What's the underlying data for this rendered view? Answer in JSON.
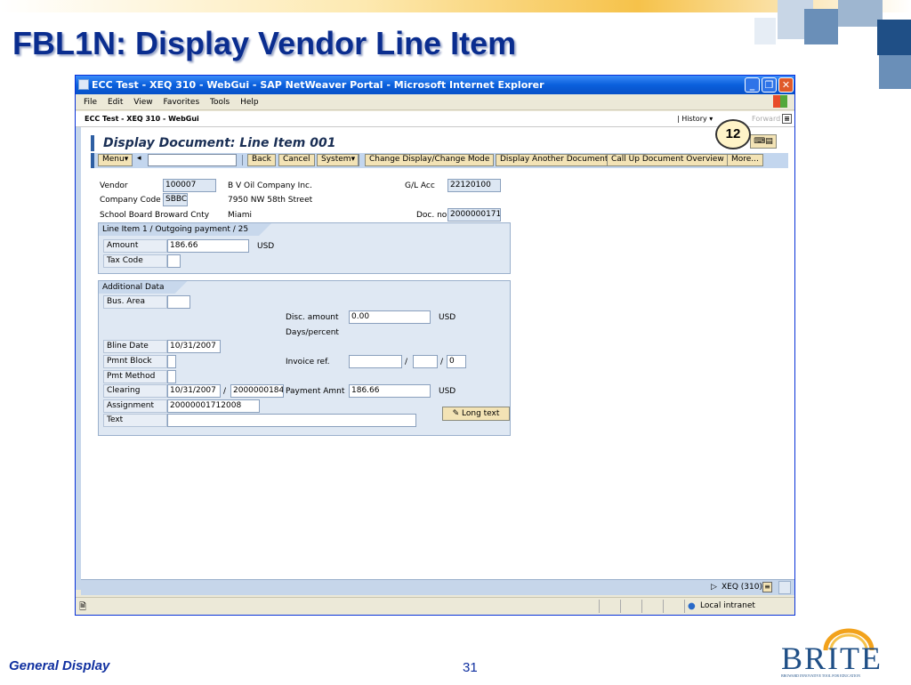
{
  "slide": {
    "title": "FBL1N: Display Vendor Line Item",
    "footer_left": "General Display",
    "page_number": "31",
    "callout": "12",
    "brite_logo": "BRITE",
    "brite_tagline": "BROWARD INNOVATIVE TOOL FOR EDUCATION"
  },
  "browser": {
    "window_title": "ECC Test - XEQ 310 - WebGui - SAP NetWeaver Portal - Microsoft Internet Explorer",
    "menu": [
      "File",
      "Edit",
      "View",
      "Favorites",
      "Tools",
      "Help"
    ],
    "portal_title": "ECC Test - XEQ 310 - WebGui",
    "history": "History",
    "forward": "Forward",
    "status_zone": "Local intranet"
  },
  "sap": {
    "page_title": "Display Document: Line Item 001",
    "toolbar": {
      "menu": "Menu",
      "back": "Back",
      "cancel": "Cancel",
      "system": "System",
      "change_mode": "Change Display/Change Mode",
      "another_doc": "Display Another Document",
      "call_up": "Call Up Document Overview",
      "more": "More..."
    },
    "header": {
      "vendor_label": "Vendor",
      "vendor": "100007",
      "vendor_name": "B V Oil Company Inc.",
      "glacc_label": "G/L Acc",
      "glacc": "22120100",
      "company_label": "Company Code",
      "company": "SBBC",
      "street": "7950 NW 58th Street",
      "school": "School Board Broward Cnty",
      "city": "Miami",
      "docno_label": "Doc. no.",
      "docno": "2000000171"
    },
    "line_item": {
      "heading": "Line Item 1 / Outgoing payment / 25",
      "amount_label": "Amount",
      "amount": "186.66",
      "currency": "USD",
      "taxcode_label": "Tax Code",
      "taxcode": ""
    },
    "additional": {
      "heading": "Additional Data",
      "busarea_label": "Bus. Area",
      "busarea": "",
      "disc_label": "Disc. amount",
      "disc": "0.00",
      "disc_currency": "USD",
      "days_label": "Days/percent",
      "bline_label": "Bline Date",
      "bline": "10/31/2007",
      "pmntblock_label": "Pmnt Block",
      "pmntblock": "",
      "invoice_label": "Invoice ref.",
      "invoice1": "",
      "invoice2": "",
      "invoice3": "0",
      "slash": "/",
      "pmtmethod_label": "Pmt Method",
      "pmtmethod": "",
      "clearing_label": "Clearing",
      "clearing_date": "10/31/2007",
      "clearing_doc": "2000000184",
      "payment_label": "Payment Amnt",
      "payment": "186.66",
      "payment_currency": "USD",
      "assignment_label": "Assignment",
      "assignment": "20000001712008",
      "text_label": "Text",
      "text": "",
      "long_text": "Long text"
    },
    "status": {
      "system": "XEQ (310)"
    }
  }
}
